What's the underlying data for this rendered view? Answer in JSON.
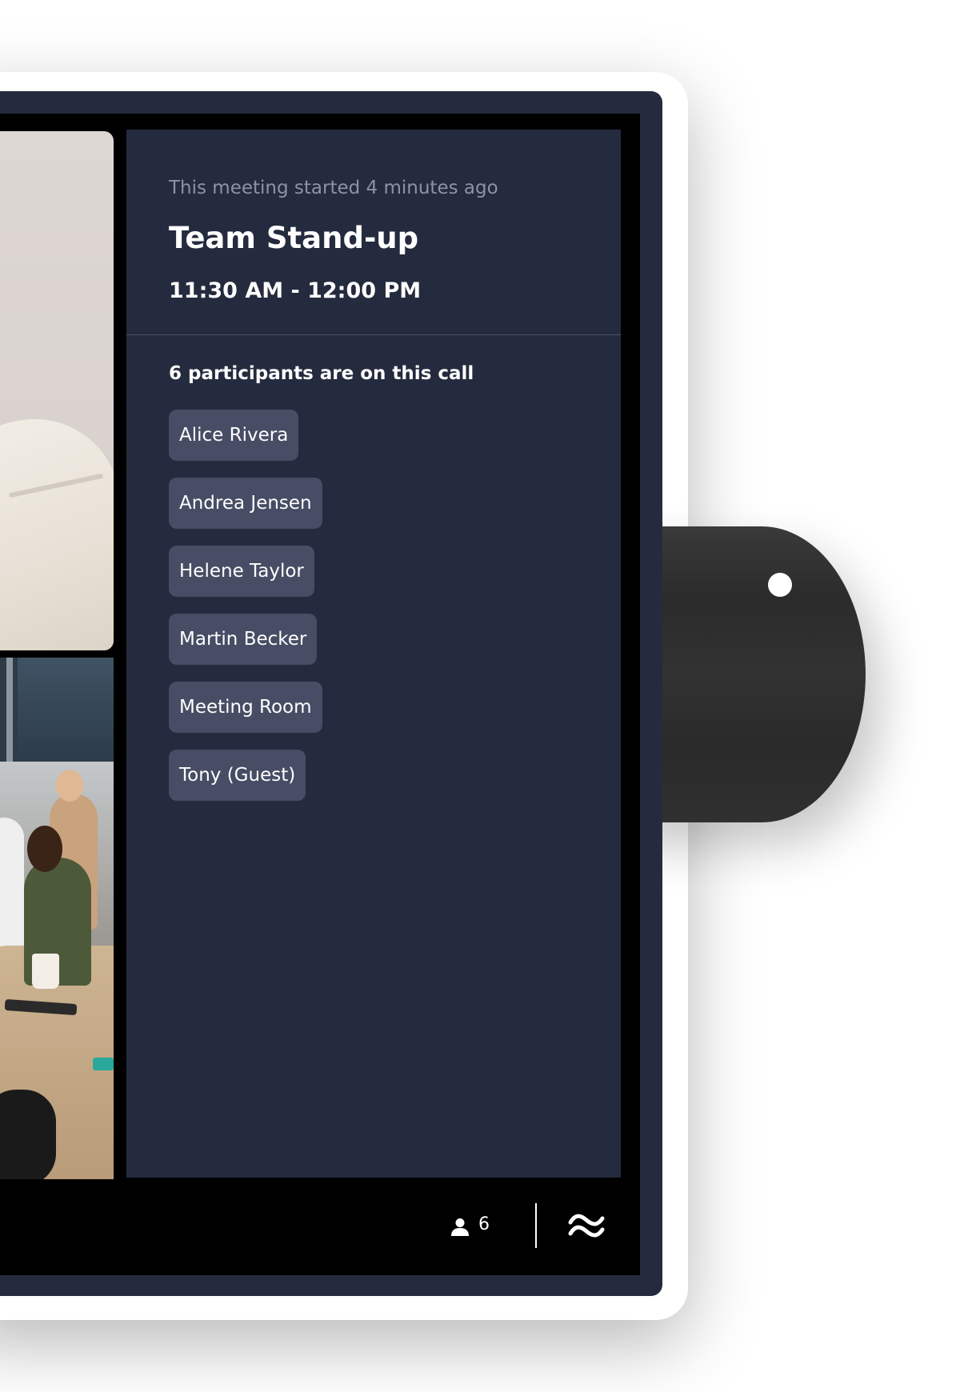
{
  "meeting": {
    "started_text": "This meeting started 4 minutes ago",
    "title": "Team Stand-up",
    "time_range": "11:30 AM - 12:00 PM"
  },
  "participants": {
    "heading": "6 participants are on this call",
    "list": [
      "Alice Rivera",
      "Andrea Jensen",
      "Helene Taylor",
      "Martin Becker",
      "Meeting Room",
      "Tony (Guest)"
    ]
  },
  "status_bar": {
    "participant_count": "6",
    "count_icon": "person-icon",
    "brand_icon": "waves-icon"
  },
  "colors": {
    "frame": "#242b3d",
    "panel": "#252b3e",
    "chip": "#464d64",
    "muted_text": "#8d93a6",
    "camera": "#2f2f2f"
  }
}
